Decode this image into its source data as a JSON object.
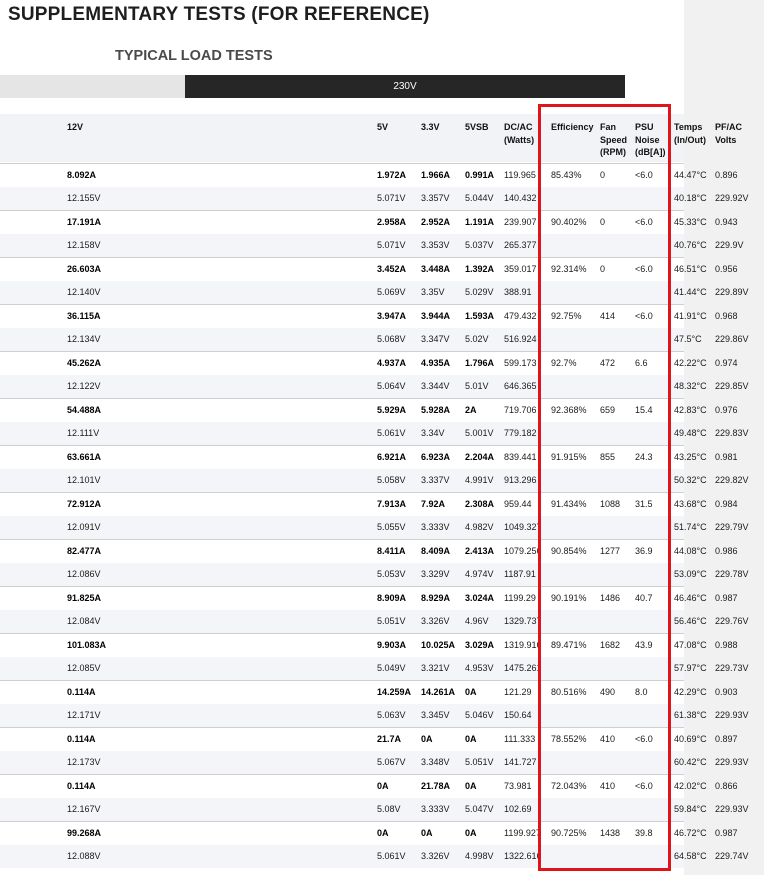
{
  "title": "SUPPLEMENTARY TESTS (FOR REFERENCE)",
  "subtitle": "TYPICAL LOAD TESTS",
  "voltage_band": "230V",
  "highlight_color": "#e0141b",
  "header_bg": "#262626",
  "columns": {
    "c12v": [
      "12V"
    ],
    "c5v": [
      "5V"
    ],
    "c33v": [
      "3.3V"
    ],
    "c5vsb": [
      "5VSB"
    ],
    "dcac": [
      "DC/AC",
      "(Watts)"
    ],
    "eff": [
      "Efficiency"
    ],
    "fan": [
      "Fan",
      "Speed",
      "(RPM)"
    ],
    "noise": [
      "PSU",
      "Noise",
      "(dB[A])"
    ],
    "temps": [
      "Temps",
      "(In/Out)"
    ],
    "pf": [
      "PF/AC",
      "Volts"
    ]
  },
  "rows": [
    {
      "a12": "8.092A",
      "v12": "12.155V",
      "a5": "1.972A",
      "v5": "5.071V",
      "a33": "1.966A",
      "v33": "3.357V",
      "asb": "0.991A",
      "vsb": "5.044V",
      "dc": "119.965",
      "ac": "140.432",
      "eff": "85.43%",
      "fan": "0",
      "noise": "<6.0",
      "tin": "44.47°C",
      "tout": "40.18°C",
      "pf": "0.896",
      "volts": "229.92V"
    },
    {
      "a12": "17.191A",
      "v12": "12.158V",
      "a5": "2.958A",
      "v5": "5.071V",
      "a33": "2.952A",
      "v33": "3.353V",
      "asb": "1.191A",
      "vsb": "5.037V",
      "dc": "239.907",
      "ac": "265.377",
      "eff": "90.402%",
      "fan": "0",
      "noise": "<6.0",
      "tin": "45.33°C",
      "tout": "40.76°C",
      "pf": "0.943",
      "volts": "229.9V"
    },
    {
      "a12": "26.603A",
      "v12": "12.140V",
      "a5": "3.452A",
      "v5": "5.069V",
      "a33": "3.448A",
      "v33": "3.35V",
      "asb": "1.392A",
      "vsb": "5.029V",
      "dc": "359.017",
      "ac": "388.91",
      "eff": "92.314%",
      "fan": "0",
      "noise": "<6.0",
      "tin": "46.51°C",
      "tout": "41.44°C",
      "pf": "0.956",
      "volts": "229.89V"
    },
    {
      "a12": "36.115A",
      "v12": "12.134V",
      "a5": "3.947A",
      "v5": "5.068V",
      "a33": "3.944A",
      "v33": "3.347V",
      "asb": "1.593A",
      "vsb": "5.02V",
      "dc": "479.432",
      "ac": "516.924",
      "eff": "92.75%",
      "fan": "414",
      "noise": "<6.0",
      "tin": "41.91°C",
      "tout": "47.5°C",
      "pf": "0.968",
      "volts": "229.86V"
    },
    {
      "a12": "45.262A",
      "v12": "12.122V",
      "a5": "4.937A",
      "v5": "5.064V",
      "a33": "4.935A",
      "v33": "3.344V",
      "asb": "1.796A",
      "vsb": "5.01V",
      "dc": "599.173",
      "ac": "646.365",
      "eff": "92.7%",
      "fan": "472",
      "noise": "6.6",
      "tin": "42.22°C",
      "tout": "48.32°C",
      "pf": "0.974",
      "volts": "229.85V"
    },
    {
      "a12": "54.488A",
      "v12": "12.111V",
      "a5": "5.929A",
      "v5": "5.061V",
      "a33": "5.928A",
      "v33": "3.34V",
      "asb": "2A",
      "vsb": "5.001V",
      "dc": "719.706",
      "ac": "779.182",
      "eff": "92.368%",
      "fan": "659",
      "noise": "15.4",
      "tin": "42.83°C",
      "tout": "49.48°C",
      "pf": "0.976",
      "volts": "229.83V"
    },
    {
      "a12": "63.661A",
      "v12": "12.101V",
      "a5": "6.921A",
      "v5": "5.058V",
      "a33": "6.923A",
      "v33": "3.337V",
      "asb": "2.204A",
      "vsb": "4.991V",
      "dc": "839.441",
      "ac": "913.296",
      "eff": "91.915%",
      "fan": "855",
      "noise": "24.3",
      "tin": "43.25°C",
      "tout": "50.32°C",
      "pf": "0.981",
      "volts": "229.82V"
    },
    {
      "a12": "72.912A",
      "v12": "12.091V",
      "a5": "7.913A",
      "v5": "5.055V",
      "a33": "7.92A",
      "v33": "3.333V",
      "asb": "2.308A",
      "vsb": "4.982V",
      "dc": "959.44",
      "ac": "1049.327",
      "eff": "91.434%",
      "fan": "1088",
      "noise": "31.5",
      "tin": "43.68°C",
      "tout": "51.74°C",
      "pf": "0.984",
      "volts": "229.79V"
    },
    {
      "a12": "82.477A",
      "v12": "12.086V",
      "a5": "8.411A",
      "v5": "5.053V",
      "a33": "8.409A",
      "v33": "3.329V",
      "asb": "2.413A",
      "vsb": "4.974V",
      "dc": "1079.256",
      "ac": "1187.91",
      "eff": "90.854%",
      "fan": "1277",
      "noise": "36.9",
      "tin": "44.08°C",
      "tout": "53.09°C",
      "pf": "0.986",
      "volts": "229.78V"
    },
    {
      "a12": "91.825A",
      "v12": "12.084V",
      "a5": "8.909A",
      "v5": "5.051V",
      "a33": "8.929A",
      "v33": "3.326V",
      "asb": "3.024A",
      "vsb": "4.96V",
      "dc": "1199.29",
      "ac": "1329.737",
      "eff": "90.191%",
      "fan": "1486",
      "noise": "40.7",
      "tin": "46.46°C",
      "tout": "56.46°C",
      "pf": "0.987",
      "volts": "229.76V"
    },
    {
      "a12": "101.083A",
      "v12": "12.085V",
      "a5": "9.903A",
      "v5": "5.049V",
      "a33": "10.025A",
      "v33": "3.321V",
      "asb": "3.029A",
      "vsb": "4.953V",
      "dc": "1319.916",
      "ac": "1475.261",
      "eff": "89.471%",
      "fan": "1682",
      "noise": "43.9",
      "tin": "47.08°C",
      "tout": "57.97°C",
      "pf": "0.988",
      "volts": "229.73V"
    },
    {
      "a12": "0.114A",
      "v12": "12.171V",
      "a5": "14.259A",
      "v5": "5.063V",
      "a33": "14.261A",
      "v33": "3.345V",
      "asb": "0A",
      "vsb": "5.046V",
      "dc": "121.29",
      "ac": "150.64",
      "eff": "80.516%",
      "fan": "490",
      "noise": "8.0",
      "tin": "42.29°C",
      "tout": "61.38°C",
      "pf": "0.903",
      "volts": "229.93V"
    },
    {
      "a12": "0.114A",
      "v12": "12.173V",
      "a5": "21.7A",
      "v5": "5.067V",
      "a33": "0A",
      "v33": "3.348V",
      "asb": "0A",
      "vsb": "5.051V",
      "dc": "111.333",
      "ac": "141.727",
      "eff": "78.552%",
      "fan": "410",
      "noise": "<6.0",
      "tin": "40.69°C",
      "tout": "60.42°C",
      "pf": "0.897",
      "volts": "229.93V"
    },
    {
      "a12": "0.114A",
      "v12": "12.167V",
      "a5": "0A",
      "v5": "5.08V",
      "a33": "21.78A",
      "v33": "3.333V",
      "asb": "0A",
      "vsb": "5.047V",
      "dc": "73.981",
      "ac": "102.69",
      "eff": "72.043%",
      "fan": "410",
      "noise": "<6.0",
      "tin": "42.02°C",
      "tout": "59.84°C",
      "pf": "0.866",
      "volts": "229.93V"
    },
    {
      "a12": "99.268A",
      "v12": "12.088V",
      "a5": "0A",
      "v5": "5.061V",
      "a33": "0A",
      "v33": "3.326V",
      "asb": "0A",
      "vsb": "4.998V",
      "dc": "1199.927",
      "ac": "1322.616",
      "eff": "90.725%",
      "fan": "1438",
      "noise": "39.8",
      "tin": "46.72°C",
      "tout": "64.58°C",
      "pf": "0.987",
      "volts": "229.74V"
    }
  ]
}
